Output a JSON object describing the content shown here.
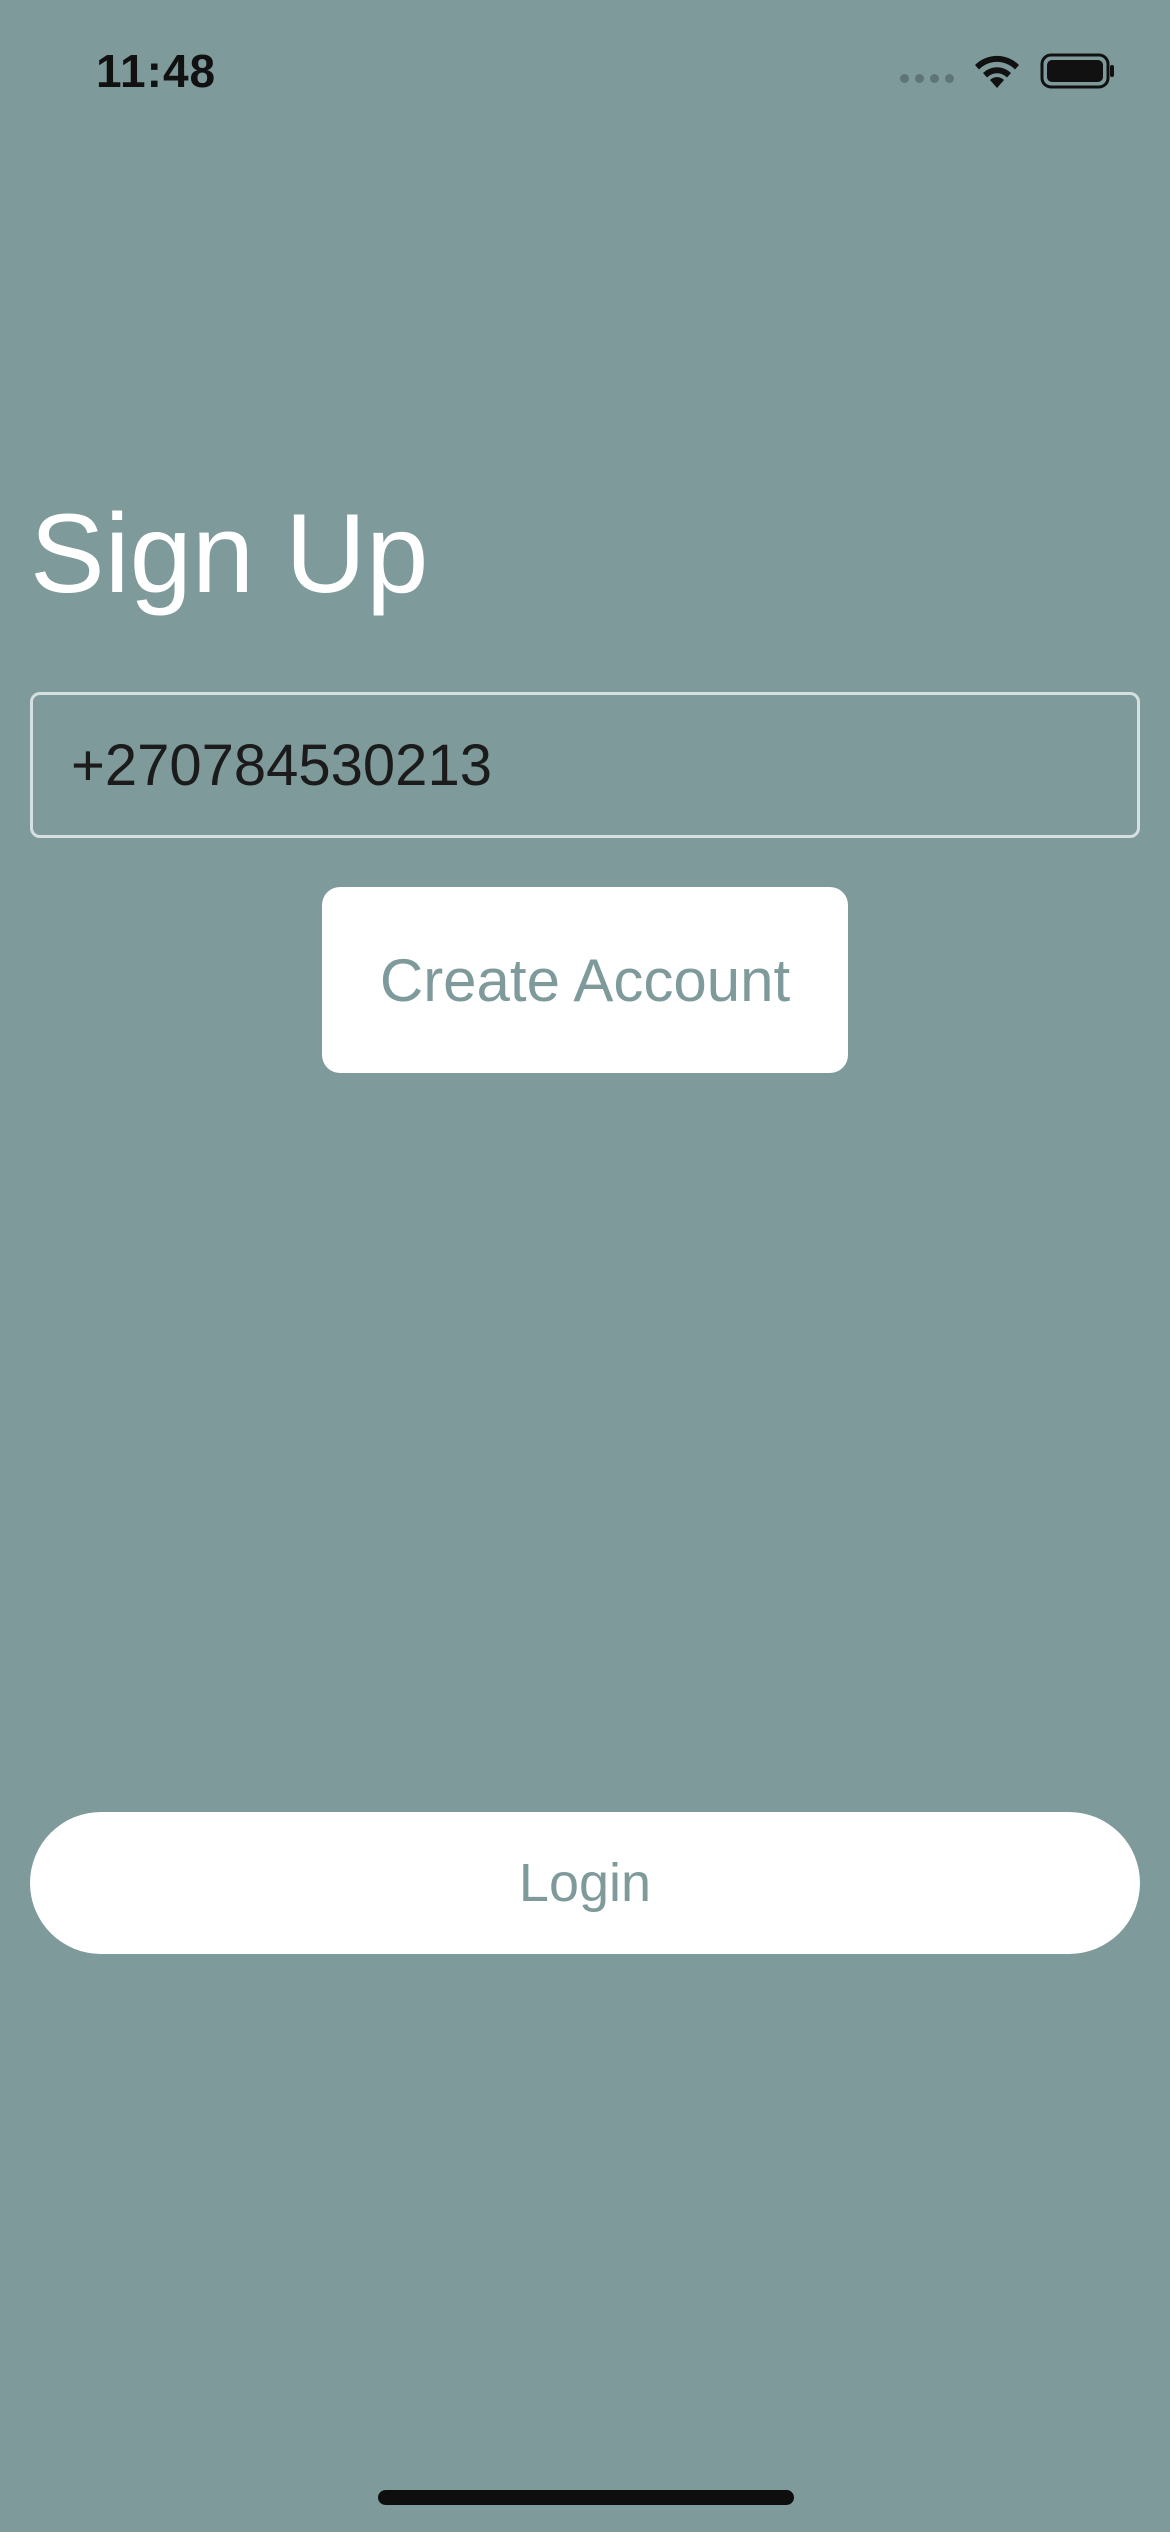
{
  "status_bar": {
    "time": "11:48"
  },
  "signup": {
    "title": "Sign Up",
    "phone_value": "+270784530213",
    "create_account_label": "Create Account"
  },
  "login": {
    "label": "Login"
  },
  "colors": {
    "background": "#7f9a9b",
    "accent_text": "#7f9a9b",
    "button_bg": "#ffffff"
  },
  "icons": {
    "signal": "signal-dots-icon",
    "wifi": "wifi-icon",
    "battery": "battery-icon"
  }
}
